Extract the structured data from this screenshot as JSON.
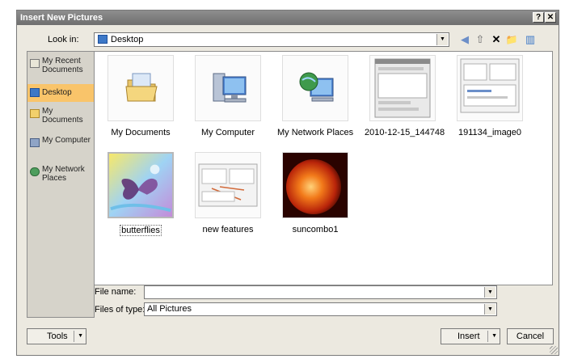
{
  "window": {
    "title": "Insert New Pictures",
    "help_label": "?",
    "close_label": "✕"
  },
  "lookin": {
    "label": "Look in:",
    "value": "Desktop"
  },
  "toolbar": {
    "back": "◀",
    "up": "⇧",
    "delete": "✕",
    "new_folder": "📁",
    "views": "▥"
  },
  "places": [
    {
      "label": "My Recent Documents",
      "icon": "recent-documents-icon"
    },
    {
      "label": "Desktop",
      "icon": "desktop-icon",
      "selected": true
    },
    {
      "label": "My Documents",
      "icon": "my-documents-icon"
    },
    {
      "label": "My Computer",
      "icon": "my-computer-icon"
    },
    {
      "label": "My Network Places",
      "icon": "network-places-icon"
    }
  ],
  "files": [
    {
      "name": "My Documents",
      "icon": "folder-icon"
    },
    {
      "name": "My Computer",
      "icon": "computer-icon"
    },
    {
      "name": "My Network Places",
      "icon": "network-icon"
    },
    {
      "name": "2010-12-15_144748",
      "icon": "screenshot-thumbnail"
    },
    {
      "name": "191134_image0",
      "icon": "screenshot-thumbnail"
    },
    {
      "name": "butterflies",
      "icon": "butterfly-thumbnail",
      "selected": true
    },
    {
      "name": "new features",
      "icon": "screenshot-thumbnail"
    },
    {
      "name": "suncombo1",
      "icon": "sun-thumbnail"
    }
  ],
  "filename": {
    "label": "File name:",
    "value": ""
  },
  "filetype": {
    "label": "Files of type:",
    "value": "All Pictures"
  },
  "buttons": {
    "tools": "Tools",
    "insert": "Insert",
    "cancel": "Cancel"
  },
  "colors": {
    "selection": "#f9c46a",
    "title_bar": "#7f7f7f",
    "dialog_bg": "#ece9e0"
  }
}
